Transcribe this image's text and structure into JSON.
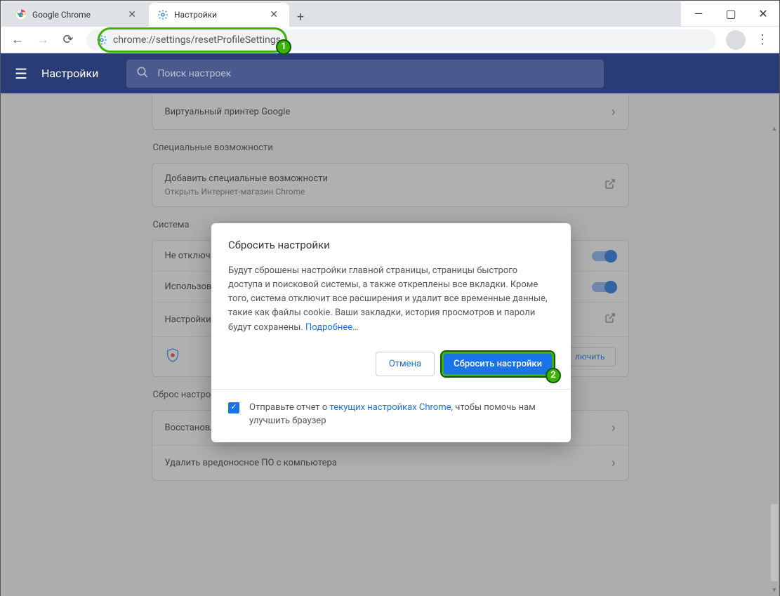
{
  "window": {
    "minimize": "—",
    "maximize": "▢",
    "close": "✕"
  },
  "tabs": [
    {
      "title": "Google Chrome",
      "icon": "chrome"
    },
    {
      "title": "Настройки",
      "icon": "gear"
    }
  ],
  "toolbar": {
    "url": "chrome://settings/resetProfileSettings"
  },
  "settings_header": {
    "title": "Настройки",
    "search_placeholder": "Поиск настроек"
  },
  "sections": {
    "print_row": "Виртуальный принтер Google",
    "accessibility_title": "Специальные возможности",
    "accessibility_row": {
      "title": "Добавить специальные возможности",
      "subtitle": "Открыть Интернет-магазин Chrome"
    },
    "system_title": "Система",
    "system_row1": "Не отключ",
    "system_row2": "Использов",
    "system_row3": "Настройки",
    "enable_btn": "лючить",
    "reset_title": "Сброс настроек и удаление вредоносного ПО",
    "reset_row1": "Восстановление настроек по умолчанию",
    "reset_row2": "Удалить вредоносное ПО с компьютера"
  },
  "dialog": {
    "title": "Сбросить настройки",
    "body1": "Будут сброшены настройки главной страницы, страницы быстрого доступа и поисковой системы, а также откреплены все вкладки. Кроме того, система отключит все расширения и удалит все временные данные, такие как файлы cookie. Ваши закладки, история просмотров и пароли будут сохранены. ",
    "learn_more": "Подробнее…",
    "cancel": "Отмена",
    "confirm": "Сбросить настройки",
    "footer_pre": "Отправьте отчет о ",
    "footer_link": "текущих настройках Chrome",
    "footer_post": ", чтобы помочь нам улучшить браузер"
  },
  "annotations": {
    "a1": "1",
    "a2": "2"
  }
}
